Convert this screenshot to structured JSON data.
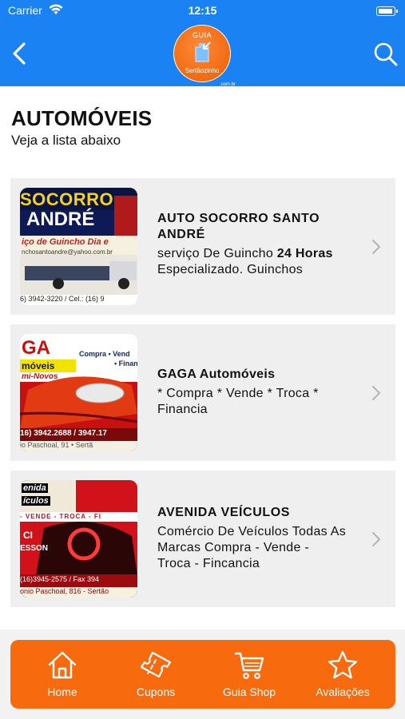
{
  "status_bar": {
    "carrier": "Carrier",
    "time": "12:15"
  },
  "nav": {
    "logo_top": "GUIA",
    "logo_bottom": "Sertãozinho",
    "logo_domain": ".com.br"
  },
  "header": {
    "title": "AUTOMÓVEIS",
    "subtitle": "Veja a lista abaixo"
  },
  "listings": [
    {
      "name_line1": "AUTO SOCORRO SANTO",
      "name_line2": "ANDRÉ",
      "desc_pre": "serviço De Guincho ",
      "desc_bold": "24 Horas",
      "desc_post": "Especializado. Guinchos",
      "thumb": {
        "headline1": "SOCORRO",
        "headline2": "ANDRÉ",
        "tagline": "iço de Guincho Dia e",
        "email": "nchosantoandre@yahoo.com.br",
        "phone": "6) 3942-3220 / Cel.: (16) 9"
      }
    },
    {
      "name": "GAGA Automóveis",
      "desc_line1": "* Compra * Vende * Troca *",
      "desc_line2": "Financia",
      "thumb": {
        "headline1": "GA",
        "headline2": "móveis",
        "tag1": "Compra • Vend",
        "tag2": "• Finan",
        "tag3": "mi-Novos",
        "phone": "16) 3942.2688 / 3947.17",
        "address": "io Paschoal, 91 • Sertã"
      }
    },
    {
      "name": "AVENIDA VEÍCULOS",
      "desc_line1": "Comércio De Veículos Todas As",
      "desc_line2": "Marcas Compra - Vende -",
      "desc_line3": "Troca - Fincancia",
      "thumb": {
        "headline1": "enida",
        "headline2": "ículos",
        "tag": "- VENDE - TROCA - FI",
        "side1": "CI",
        "side2": "ESSON",
        "phone": "(16)3945-2575  / Fax 394",
        "address": "onio Paschoal, 816 - Sertão"
      }
    }
  ],
  "tabs": [
    {
      "label": "Home",
      "icon": "home-icon"
    },
    {
      "label": "Cupons",
      "icon": "ticket-icon"
    },
    {
      "label": "Guia Shop",
      "icon": "cart-icon"
    },
    {
      "label": "Avaliações",
      "icon": "star-icon"
    }
  ],
  "colors": {
    "nav_blue": "#1a82f2",
    "accent_orange": "#f76a0e",
    "card_gray": "#efefef"
  }
}
